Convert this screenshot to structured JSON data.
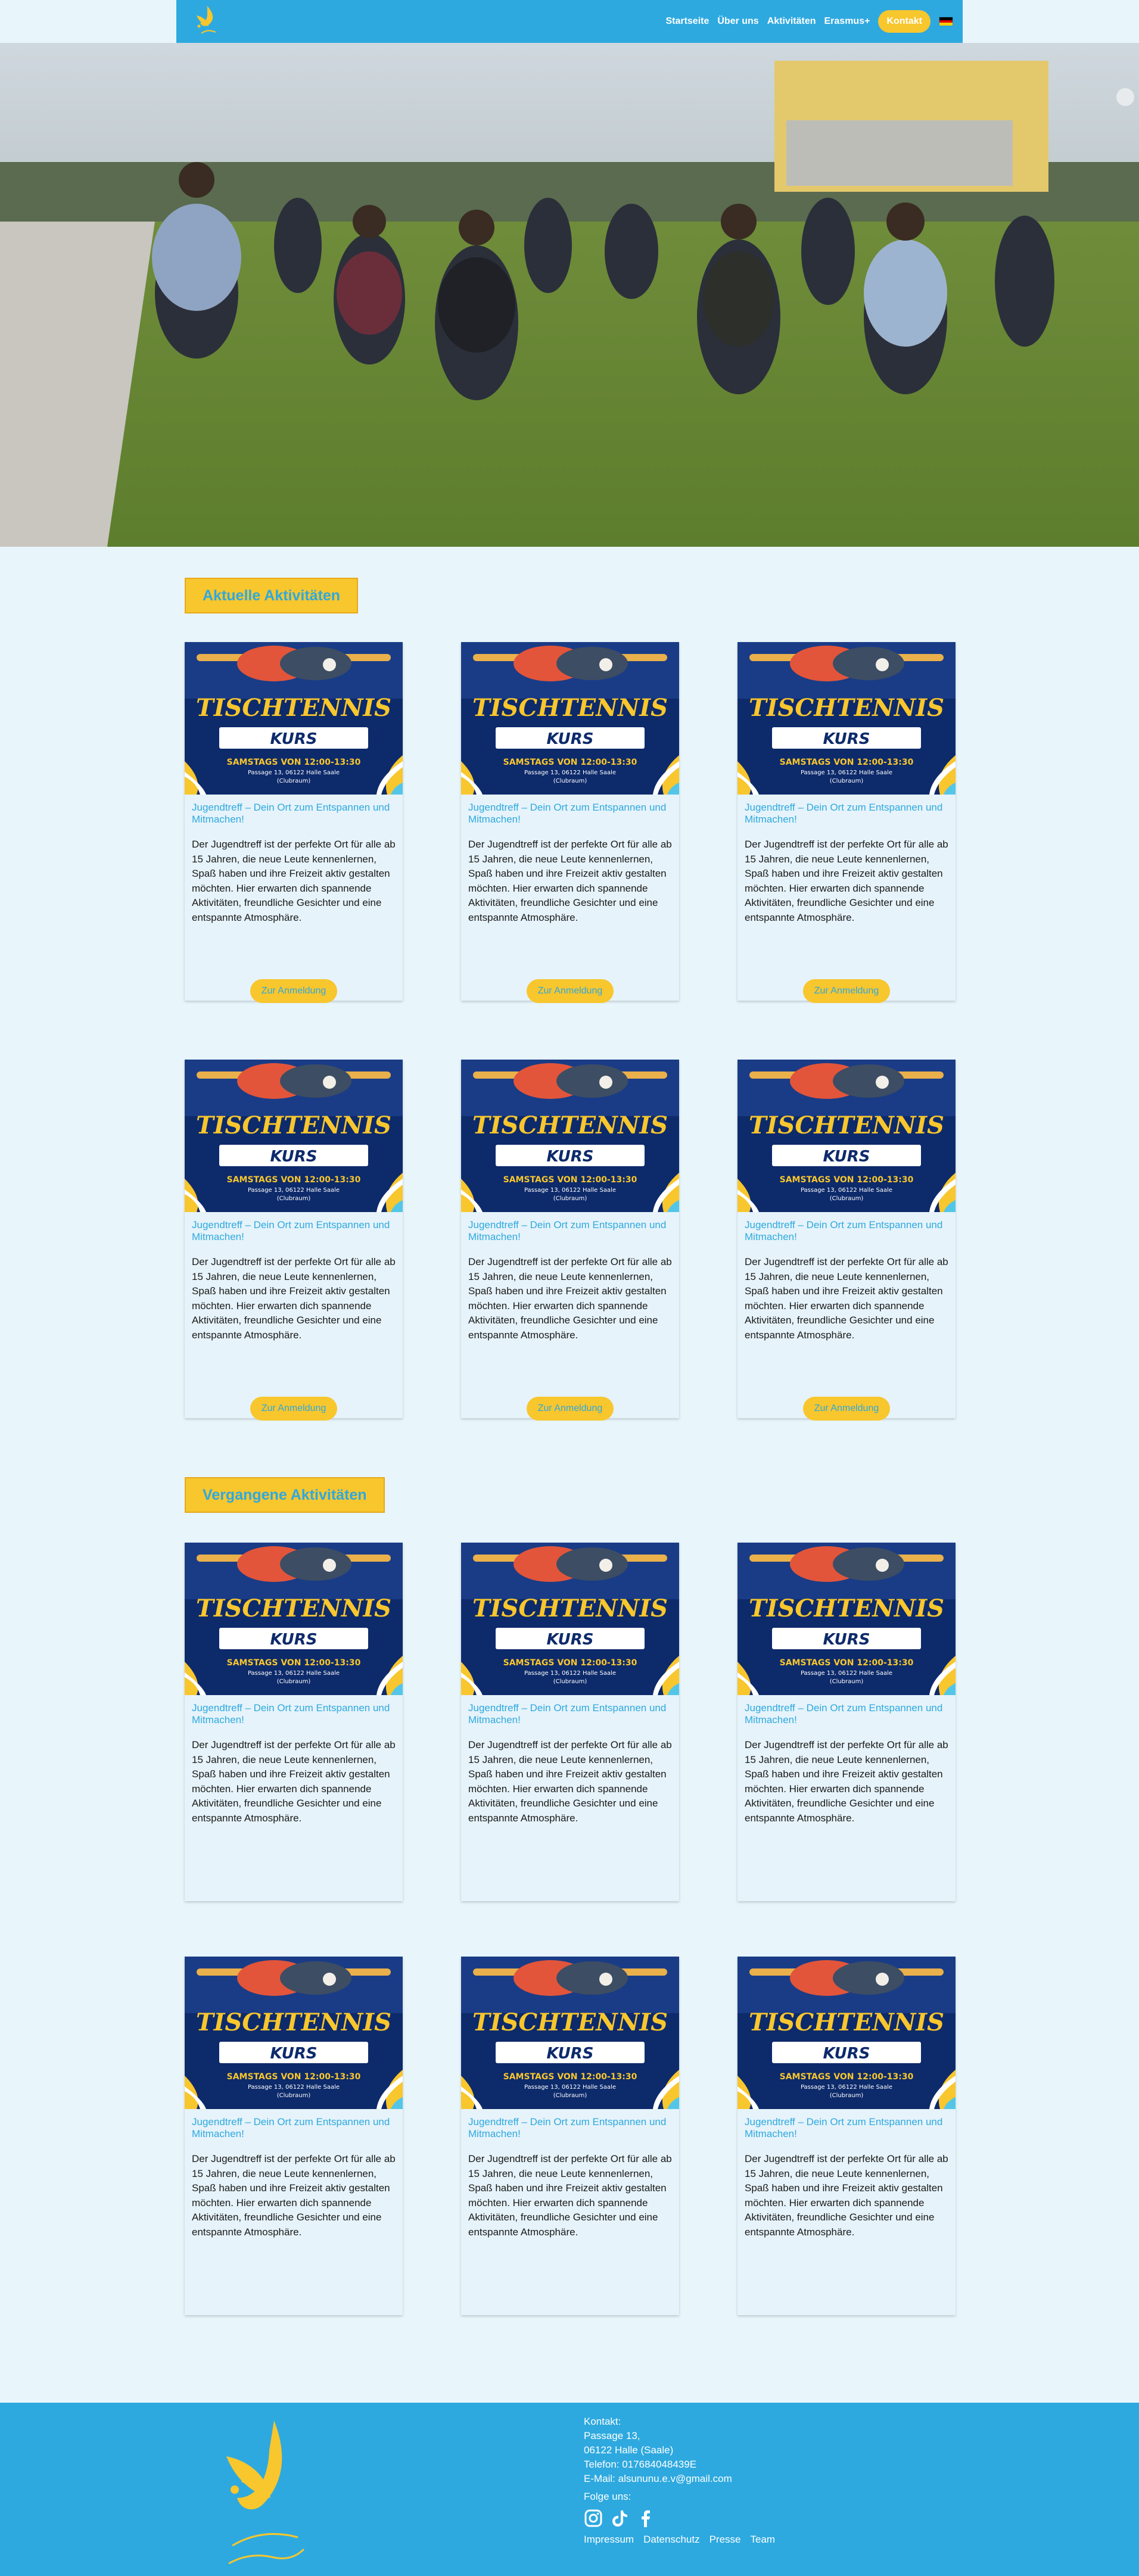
{
  "header": {
    "nav": [
      "Startseite",
      "Über uns",
      "Aktivitäten",
      "Erasmus+"
    ],
    "contact_label": "Kontakt",
    "language_flag": "german-flag-icon"
  },
  "sections": {
    "current_title": "Aktuelle Aktivitäten",
    "past_title": "Vergangene Aktivitäten"
  },
  "card": {
    "poster": {
      "title": "TISCHTENNIS",
      "subtitle": "KURS",
      "schedule": "SAMSTAGS VON 12:00-13:30",
      "address": "Passage 13, 06122 Halle Saale",
      "room": "(Clubraum)"
    },
    "heading": "Jugendtreff – Dein Ort zum Entspannen und Mitmachen!",
    "text": "Der Jugendtreff ist der perfekte Ort für alle ab 15 Jahren, die neue Leute kennenlernen, Spaß haben und ihre Freizeit aktiv gestalten möchten. Hier erwarten dich spannende Aktivitäten, freundliche Gesichter und eine entspannte Atmosphäre.",
    "button": "Zur Anmeldung"
  },
  "footer": {
    "contact_label": "Kontakt:",
    "street": "Passage 13,",
    "city": "06122 Halle (Saale)",
    "phone": "Telefon: 017684048439E",
    "email": "E-Mail: alsununu.e.v@gmail.com",
    "follow_label": "Folge uns:",
    "social": [
      "instagram-icon",
      "tiktok-icon",
      "facebook-icon"
    ],
    "links": [
      "Impressum",
      "Datenschutz",
      "Presse",
      "Team"
    ]
  },
  "colors": {
    "primary_blue": "#2ea9df",
    "accent_yellow": "#f8c62d",
    "page_bg": "#e8f5fb",
    "poster_navy": "#0d2a6b"
  }
}
